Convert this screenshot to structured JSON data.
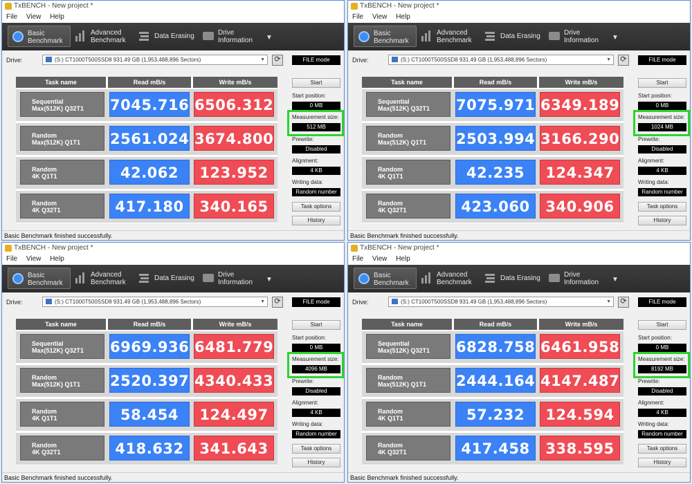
{
  "app": {
    "title": "TxBENCH - New project *",
    "menu": [
      "File",
      "View",
      "Help"
    ],
    "toolbar": {
      "basic": [
        "Basic",
        "Benchmark"
      ],
      "advanced": [
        "Advanced",
        "Benchmark"
      ],
      "erasing": "Data Erasing",
      "drive_info": [
        "Drive",
        "Information"
      ],
      "more": "▼"
    },
    "drive_label": "Drive:",
    "drive_value": "(S:) CT1000T500SSD8  931.49 GB (1,953,488,896 Sectors)",
    "file_mode": "FILE mode",
    "columns": [
      "Task name",
      "Read mB/s",
      "Write mB/s"
    ],
    "tasks": [
      [
        "Sequential",
        "Max(512K) Q32T1"
      ],
      [
        "Random",
        "Max(512K) Q1T1"
      ],
      [
        "Random",
        "4K Q1T1"
      ],
      [
        "Random",
        "4K Q32T1"
      ]
    ],
    "side": {
      "start": "Start",
      "start_position_label": "Start position:",
      "start_position": "0 MB",
      "measurement_label": "Measurement size:",
      "prewrite_label": "Prewrite:",
      "prewrite": "Disabled",
      "alignment_label": "Alignment:",
      "alignment": "4 KB",
      "writing_label": "Writing data:",
      "writing": "Random number",
      "task_options": "Task options",
      "history": "History"
    },
    "status": "Basic Benchmark finished successfully.",
    "colors": {
      "read": "#3b82f6",
      "write": "#ef4c55",
      "highlight": "#2cd52c"
    }
  },
  "panels": [
    {
      "measurement": "512 MB",
      "results": [
        [
          "7045.716",
          "6506.312"
        ],
        [
          "2561.024",
          "3674.800"
        ],
        [
          "42.062",
          "123.952"
        ],
        [
          "417.180",
          "340.165"
        ]
      ]
    },
    {
      "measurement": "1024 MB",
      "results": [
        [
          "7075.971",
          "6349.189"
        ],
        [
          "2503.994",
          "3166.290"
        ],
        [
          "42.235",
          "124.347"
        ],
        [
          "423.060",
          "340.906"
        ]
      ]
    },
    {
      "measurement": "4096 MB",
      "results": [
        [
          "6969.936",
          "6481.779"
        ],
        [
          "2520.397",
          "4340.433"
        ],
        [
          "58.454",
          "124.497"
        ],
        [
          "418.632",
          "341.643"
        ]
      ]
    },
    {
      "measurement": "8192 MB",
      "results": [
        [
          "6828.758",
          "6461.958"
        ],
        [
          "2444.164",
          "4147.487"
        ],
        [
          "57.232",
          "124.594"
        ],
        [
          "417.458",
          "338.595"
        ]
      ]
    }
  ]
}
